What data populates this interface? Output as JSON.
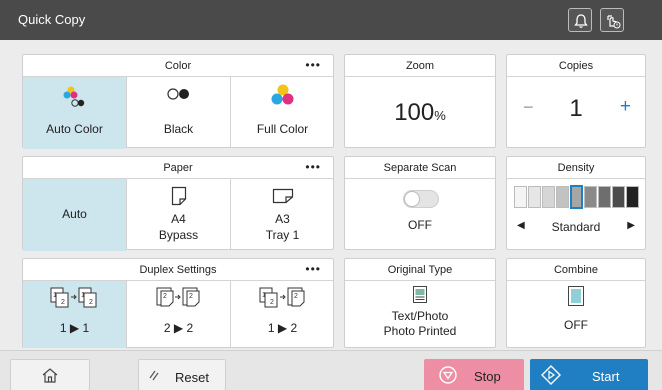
{
  "title": "Quick Copy",
  "color": {
    "header": "Color",
    "more": "•••",
    "options": [
      "Auto Color",
      "Black",
      "Full Color"
    ],
    "selected": "Auto Color"
  },
  "zoom": {
    "header": "Zoom",
    "value": "100",
    "unit": "%"
  },
  "copies": {
    "header": "Copies",
    "value": "1",
    "minus": "−",
    "plus": "+"
  },
  "paper": {
    "header": "Paper",
    "more": "•••",
    "auto": "Auto",
    "options": [
      {
        "size": "A4",
        "source": "Bypass"
      },
      {
        "size": "A3",
        "source": "Tray 1"
      }
    ]
  },
  "separate_scan": {
    "header": "Separate Scan",
    "value": "OFF"
  },
  "density": {
    "header": "Density",
    "value": "Standard",
    "level": 5,
    "levels": 9
  },
  "duplex": {
    "header": "Duplex Settings",
    "more": "•••",
    "options": [
      "1 ▶ 1",
      "2 ▶ 2",
      "1 ▶ 2"
    ]
  },
  "original_type": {
    "header": "Original Type",
    "line1": "Text/Photo",
    "line2": "Photo Printed"
  },
  "combine": {
    "header": "Combine",
    "value": "OFF"
  },
  "bottom": {
    "reset": "Reset",
    "stop": "Stop",
    "start": "Start"
  },
  "colors": {
    "accent": "#1f7fc2",
    "stop": "#ee8ea5",
    "selected": "#cde5ec"
  },
  "icons": [
    "bell-icon",
    "hand-touch-icon",
    "home-icon",
    "reset-icon",
    "stop-icon",
    "start-icon"
  ]
}
